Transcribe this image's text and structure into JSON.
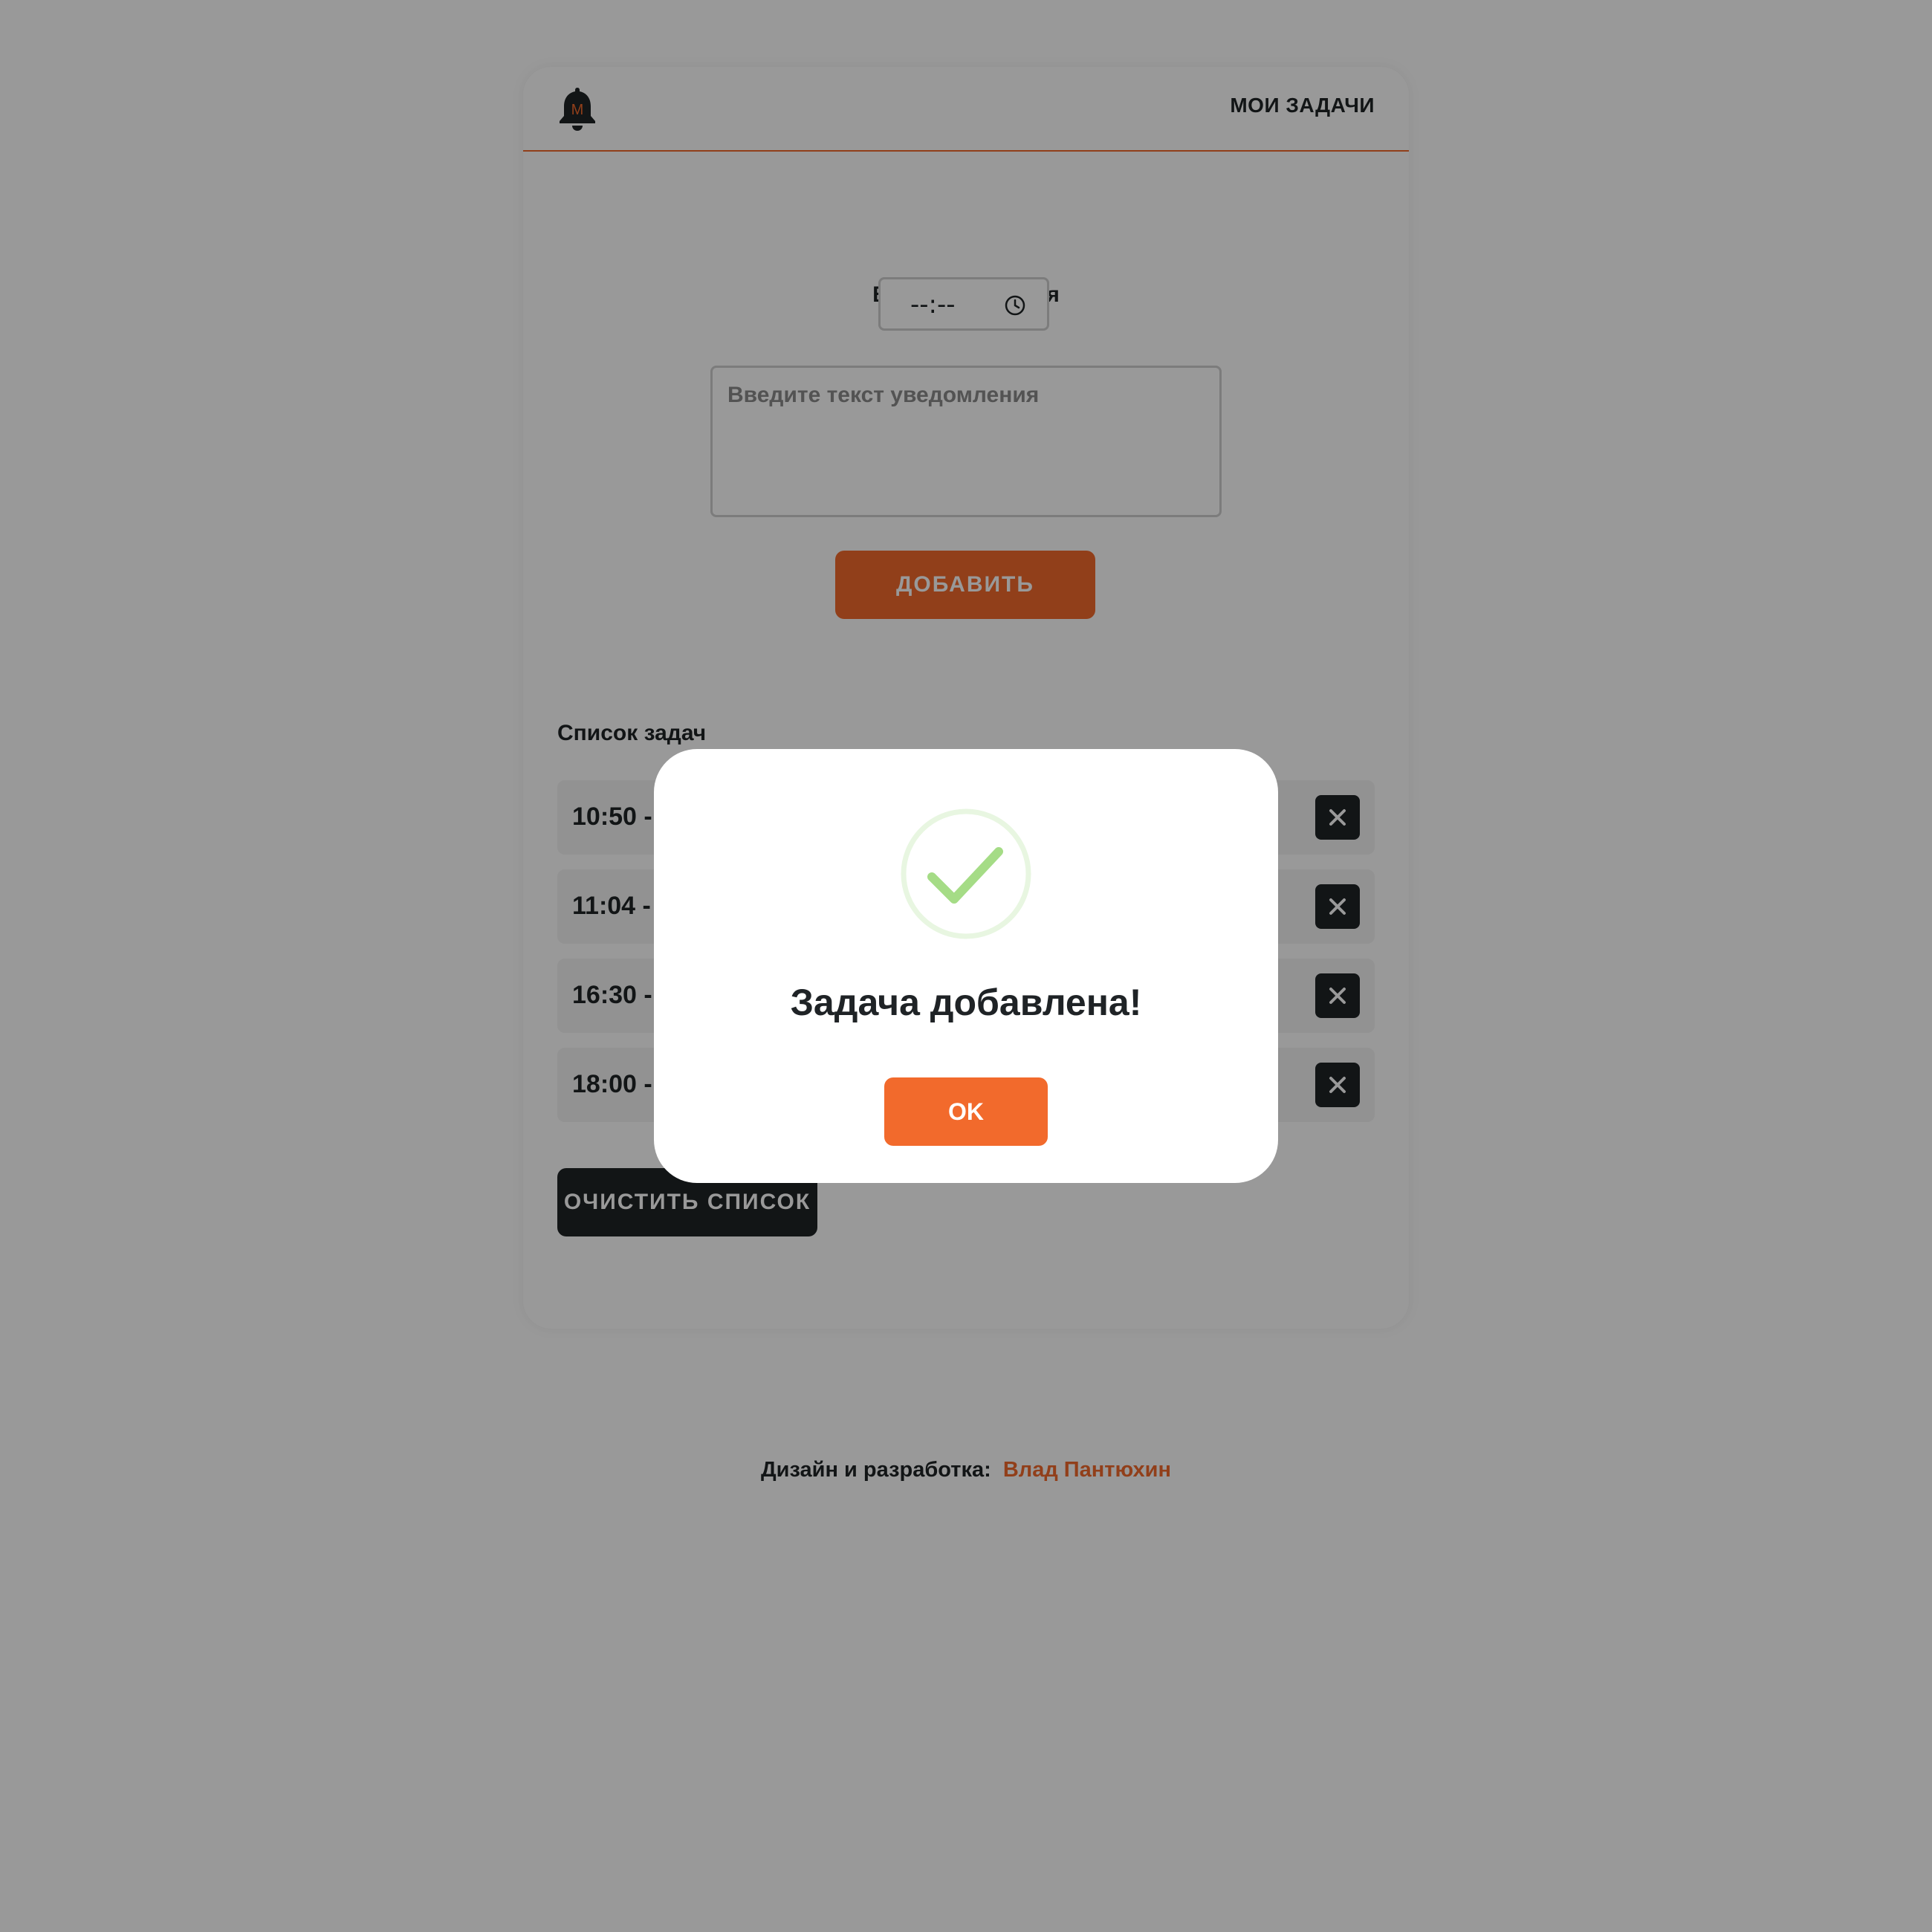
{
  "header": {
    "logo_letter": "M",
    "nav_label": "МОИ ЗАДАЧИ"
  },
  "form": {
    "time_label": "Выберите время",
    "time_value": "--:--",
    "message_placeholder": "Введите текст уведомления",
    "add_label": "ДОБАВИТЬ"
  },
  "list": {
    "title": "Список задач",
    "items": [
      {
        "text": "10:50 -"
      },
      {
        "text": "11:04 -"
      },
      {
        "text": "16:30 -"
      },
      {
        "text": "18:00 -"
      }
    ],
    "clear_label": "ОЧИСТИТЬ СПИСОК"
  },
  "footer": {
    "label": "Дизайн и разработка:",
    "author": "Влад Пантюхин"
  },
  "modal": {
    "title": "Задача добавлена!",
    "ok_label": "OK",
    "icon": "check-circle-icon"
  },
  "colors": {
    "accent": "#f26a2c",
    "dark": "#1f2326",
    "success": "#a5dc86",
    "success_ring": "#e8f6e1"
  }
}
